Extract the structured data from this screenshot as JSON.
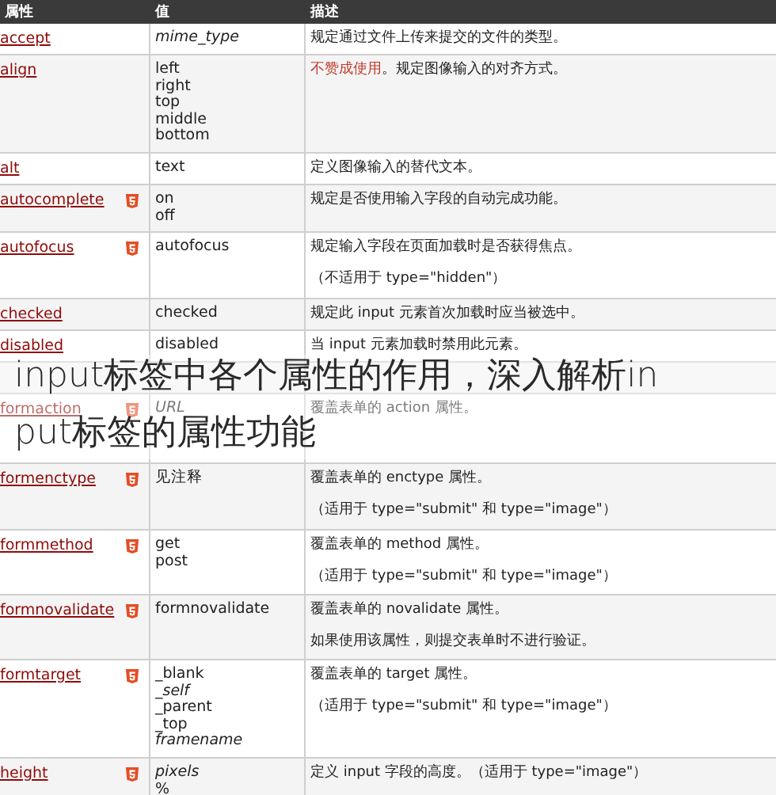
{
  "table": {
    "columns": [
      "属性",
      "值",
      "描述"
    ],
    "rows": [
      {
        "attribute": "accept",
        "html5": false,
        "values": [
          {
            "text": "mime_type",
            "italic": true
          }
        ],
        "description": [
          [
            {
              "text": "规定通过文件上传来提交的文件的类型。",
              "kind": "plain"
            }
          ]
        ]
      },
      {
        "attribute": "align",
        "html5": false,
        "values": [
          {
            "text": "left",
            "italic": false
          },
          {
            "text": "right",
            "italic": false
          },
          {
            "text": "top",
            "italic": false
          },
          {
            "text": "middle",
            "italic": false
          },
          {
            "text": "bottom",
            "italic": false
          }
        ],
        "description": [
          [
            {
              "text": "不赞成使用",
              "kind": "link"
            },
            {
              "text": "。规定图像输入的对齐方式。",
              "kind": "plain"
            }
          ]
        ]
      },
      {
        "attribute": "alt",
        "html5": false,
        "values": [
          {
            "text": "text",
            "italic": false
          }
        ],
        "description": [
          [
            {
              "text": "定义图像输入的替代文本。",
              "kind": "plain"
            }
          ]
        ]
      },
      {
        "attribute": "autocomplete",
        "html5": true,
        "values": [
          {
            "text": "on",
            "italic": false
          },
          {
            "text": "off",
            "italic": false
          }
        ],
        "description": [
          [
            {
              "text": "规定是否使用输入字段的自动完成功能。",
              "kind": "plain"
            }
          ]
        ]
      },
      {
        "attribute": "autofocus",
        "html5": true,
        "values": [
          {
            "text": "autofocus",
            "italic": false
          }
        ],
        "description": [
          [
            {
              "text": "规定输入字段在页面加载时是否获得焦点。",
              "kind": "plain"
            }
          ],
          [
            {
              "text": "（不适用于 type=\"hidden\"）",
              "kind": "plain"
            }
          ]
        ]
      },
      {
        "attribute": "checked",
        "html5": false,
        "values": [
          {
            "text": "checked",
            "italic": false
          }
        ],
        "description": [
          [
            {
              "text": "规定此 input 元素首次加载时应当被选中。",
              "kind": "plain"
            }
          ]
        ]
      },
      {
        "attribute": "disabled",
        "html5": false,
        "values": [
          {
            "text": "disabled",
            "italic": false
          }
        ],
        "description": [
          [
            {
              "text": "当 input 元素加载时禁用此元素。",
              "kind": "plain"
            }
          ]
        ]
      },
      {
        "attribute": "",
        "html5": false,
        "values": [],
        "description": []
      },
      {
        "attribute": "formaction",
        "html5": true,
        "values": [
          {
            "text": "URL",
            "italic": true
          }
        ],
        "description": [
          [
            {
              "text": "覆盖表单的 action 属性。",
              "kind": "plain"
            }
          ]
        ]
      },
      {
        "attribute": "formenctype",
        "html5": true,
        "values": [
          {
            "text": "见注释",
            "italic": false
          }
        ],
        "description": [
          [
            {
              "text": "覆盖表单的 enctype 属性。",
              "kind": "plain"
            }
          ],
          [
            {
              "text": "（适用于 type=\"submit\" 和 type=\"image\"）",
              "kind": "plain"
            }
          ]
        ]
      },
      {
        "attribute": "formmethod",
        "html5": true,
        "values": [
          {
            "text": "get",
            "italic": false
          },
          {
            "text": "post",
            "italic": false
          }
        ],
        "description": [
          [
            {
              "text": "覆盖表单的 method 属性。",
              "kind": "plain"
            }
          ],
          [
            {
              "text": "（适用于 type=\"submit\" 和 type=\"image\"）",
              "kind": "plain"
            }
          ]
        ]
      },
      {
        "attribute": "formnovalidate",
        "html5": true,
        "values": [
          {
            "text": "formnovalidate",
            "italic": false
          }
        ],
        "description": [
          [
            {
              "text": "覆盖表单的 novalidate 属性。",
              "kind": "plain"
            }
          ],
          [
            {
              "text": "如果使用该属性，则提交表单时不进行验证。",
              "kind": "plain"
            }
          ]
        ]
      },
      {
        "attribute": "formtarget",
        "html5": true,
        "values": [
          {
            "text": "_blank",
            "italic": false
          },
          {
            "text": "_self",
            "italic": true
          },
          {
            "text": "_parent",
            "italic": false
          },
          {
            "text": "_top",
            "italic": false
          },
          {
            "text": "framename",
            "italic": true
          }
        ],
        "description": [
          [
            {
              "text": "覆盖表单的 target 属性。",
              "kind": "plain"
            }
          ],
          [
            {
              "text": "（适用于 type=\"submit\" 和 type=\"image\"）",
              "kind": "plain"
            }
          ]
        ]
      },
      {
        "attribute": "height",
        "html5": true,
        "values": [
          {
            "text": "pixels",
            "italic": true
          },
          {
            "text": "%",
            "italic": false
          }
        ],
        "description": [
          [
            {
              "text": "定义 input 字段的高度。（适用于 type=\"image\"）",
              "kind": "plain"
            }
          ]
        ]
      }
    ]
  },
  "caption": {
    "lines": [
      "input标签中各个属性的作用，深入解析in",
      "put标签的属性功能"
    ]
  }
}
